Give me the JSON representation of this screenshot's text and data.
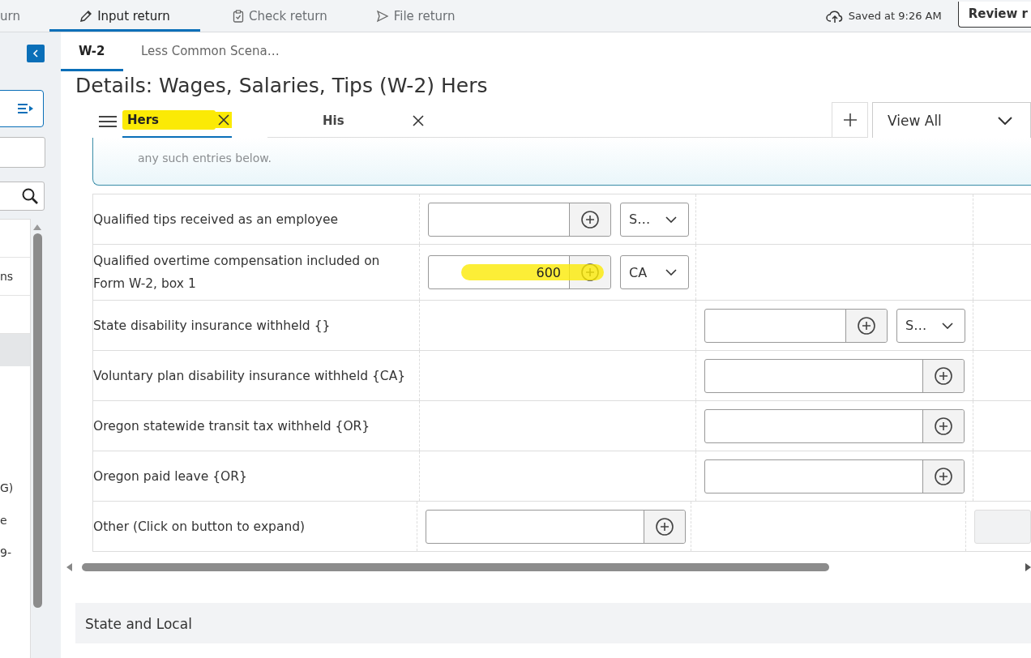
{
  "top_nav": {
    "items": [
      {
        "label": "urn",
        "selected": false
      },
      {
        "label": "Input return",
        "selected": true
      },
      {
        "label": "Check return",
        "selected": false
      },
      {
        "label": "File return",
        "selected": false
      }
    ],
    "saved_status": "Saved at 9:26 AM",
    "review_button": "Review r"
  },
  "sidebar": {
    "items": [
      {
        "selected": false
      },
      {
        "label": "ns",
        "selected": false
      },
      {
        "selected": false
      },
      {
        "selected": true
      },
      {
        "label": "G)",
        "selected": false
      },
      {
        "label": "e",
        "selected": false
      },
      {
        "label": "9-",
        "selected": false
      }
    ]
  },
  "form_tabs": [
    {
      "label": "W-2",
      "selected": true
    },
    {
      "label": "Less Common Scena…",
      "selected": false
    }
  ],
  "title": "Details: Wages, Salaries, Tips (W-2) Hers",
  "copy_tabs": [
    {
      "label": "Hers",
      "selected": true,
      "highlighted": true
    },
    {
      "label": "His",
      "selected": false,
      "highlighted": false
    }
  ],
  "view_select": "View All",
  "info_text": "any such entries below.",
  "rows": [
    {
      "label": "Qualified tips received as an employee",
      "cells": [
        {
          "kind": "field",
          "dropdown": "S…",
          "highlighted": false
        },
        {
          "kind": "empty"
        },
        {
          "kind": "empty"
        }
      ]
    },
    {
      "label": "Qualified overtime compensation included on Form W-2, box 1",
      "cells": [
        {
          "kind": "field",
          "value": "600",
          "dropdown": "CA",
          "highlighted": true
        },
        {
          "kind": "empty"
        },
        {
          "kind": "empty"
        }
      ]
    },
    {
      "label": "State disability insurance withheld {}",
      "cells": [
        {
          "kind": "empty"
        },
        {
          "kind": "field",
          "dropdown": "S…",
          "highlighted": false
        },
        {
          "kind": "empty"
        }
      ]
    },
    {
      "label": "Voluntary plan disability insurance withheld {CA}",
      "cells": [
        {
          "kind": "empty"
        },
        {
          "kind": "field",
          "highlighted": false
        },
        {
          "kind": "empty"
        }
      ]
    },
    {
      "label": "Oregon statewide transit tax withheld {OR}",
      "cells": [
        {
          "kind": "empty"
        },
        {
          "kind": "field",
          "highlighted": false
        },
        {
          "kind": "empty"
        }
      ]
    },
    {
      "label": "Oregon paid leave {OR}",
      "cells": [
        {
          "kind": "empty"
        },
        {
          "kind": "field",
          "highlighted": false
        },
        {
          "kind": "empty"
        }
      ]
    },
    {
      "label": "Other (Click on button to expand)",
      "cells": [
        {
          "kind": "field",
          "highlighted": false
        },
        {
          "kind": "empty"
        },
        {
          "kind": "button"
        }
      ]
    }
  ],
  "section": "State and Local"
}
